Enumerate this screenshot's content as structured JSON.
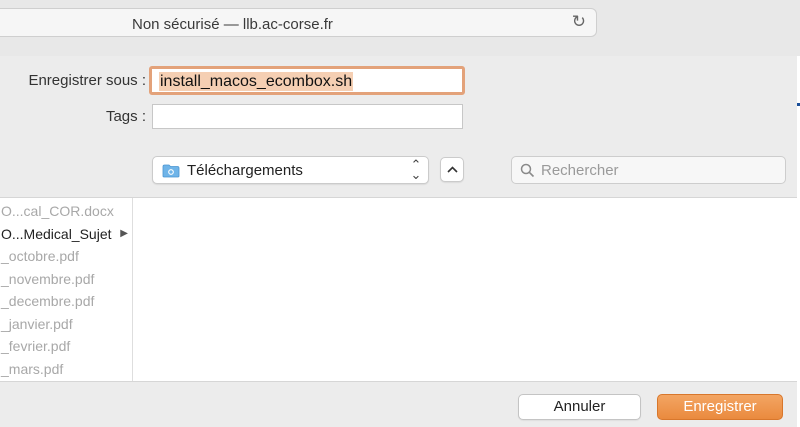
{
  "browser": {
    "url_text": "Non sécurisé — llb.ac-corse.fr",
    "reload_icon": "reload-icon"
  },
  "dialog": {
    "save_as_label": "Enregistrer sous :",
    "filename": "install_macos_ecombox.sh",
    "tags_label": "Tags :",
    "tags_value": "",
    "location": "Téléchargements",
    "search_placeholder": "Rechercher",
    "cancel_label": "Annuler",
    "save_label": "Enregistrer",
    "accent_color": "#ea8a3e"
  },
  "files": [
    {
      "name": "O...cal_COR.docx",
      "type": "file"
    },
    {
      "name": "O...Medical_Sujet",
      "type": "folder"
    },
    {
      "name": "_octobre.pdf",
      "type": "file"
    },
    {
      "name": "_novembre.pdf",
      "type": "file"
    },
    {
      "name": "_decembre.pdf",
      "type": "file"
    },
    {
      "name": "_janvier.pdf",
      "type": "file"
    },
    {
      "name": "_fevrier.pdf",
      "type": "file"
    },
    {
      "name": "_mars.pdf",
      "type": "file"
    }
  ]
}
